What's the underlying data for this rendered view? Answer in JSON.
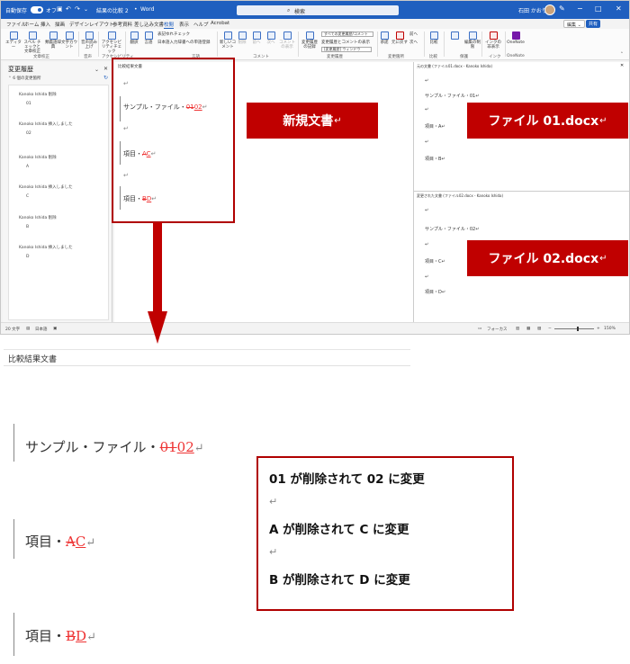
{
  "titlebar": {
    "autosave_label": "自動保存",
    "autosave_state": "オフ",
    "doc_name": "結果の比較 2",
    "app_name": "Word",
    "search_placeholder": "検索",
    "user_name": "石田 かおり"
  },
  "menu": {
    "items": [
      "ファイル",
      "ホーム",
      "挿入",
      "描画",
      "デザイン",
      "レイアウト",
      "参考資料",
      "差し込み文書",
      "校閲",
      "表示",
      "ヘルプ",
      "Acrobat"
    ],
    "active": "校閲",
    "edit_mode": "編集",
    "share": "共有"
  },
  "ribbon": {
    "buttons": [
      {
        "label": "エディター",
        "icon": "editor-icon"
      },
      {
        "label": "スペル チェックと文章校正",
        "icon": "spellcheck-icon"
      },
      {
        "label": "類義語辞典",
        "icon": "thesaurus-icon"
      },
      {
        "label": "文字カウント",
        "icon": "word-count-icon"
      },
      {
        "label": "音声読み上げ",
        "icon": "read-aloud-icon"
      },
      {
        "label": "アクセシビリティチェック",
        "icon": "accessibility-icon"
      },
      {
        "label": "翻訳",
        "icon": "translate-icon"
      },
      {
        "label": "言語",
        "icon": "language-icon"
      },
      {
        "label": "新しいコメント",
        "icon": "new-comment-icon"
      },
      {
        "label": "削除",
        "icon": "delete-comment-icon"
      },
      {
        "label": "前へ",
        "icon": "prev-comment-icon"
      },
      {
        "label": "次へ",
        "icon": "next-comment-icon"
      },
      {
        "label": "コメントの表示",
        "icon": "show-comments-icon"
      },
      {
        "label": "変更履歴の記録",
        "icon": "track-changes-icon"
      },
      {
        "label": "承諾",
        "icon": "accept-icon"
      },
      {
        "label": "元に戻す",
        "icon": "reject-icon"
      },
      {
        "label": "比較",
        "icon": "compare-icon"
      },
      {
        "label": "編集の制限",
        "icon": "restrict-icon"
      },
      {
        "label": "インクの非表示",
        "icon": "ink-icon"
      },
      {
        "label": "OneNote",
        "icon": "onenote-icon"
      }
    ],
    "small_items": [
      "表記ゆれチェック",
      "日本語入力辞書への単語登録",
      "すべての変更履歴/コメント",
      "変更履歴とコメントの表示",
      "[変更履歴] ウィンドウ",
      "前へ",
      "次へ"
    ],
    "groups": [
      "文章校正",
      "音声",
      "アクセシビリティ",
      "言語",
      "コメント",
      "変更履歴",
      "変更箇所",
      "比較",
      "保護",
      "インク",
      "OneNote"
    ]
  },
  "revisions": {
    "title": "変更履歴",
    "count": "6 個の変更箇所",
    "items": [
      {
        "author": "Kanoko Ishida 削除",
        "value": "01"
      },
      {
        "author": "Kanoko Ishida 挿入しました",
        "value": "02"
      },
      {
        "author": "Kanoko Ishida 削除",
        "value": "A"
      },
      {
        "author": "Kanoko Ishida 挿入しました",
        "value": "C"
      },
      {
        "author": "Kanoko Ishida 削除",
        "value": "B"
      },
      {
        "author": "Kanoko Ishida 挿入しました",
        "value": "D"
      }
    ]
  },
  "compared": {
    "label": "比較結果文書",
    "lines": {
      "l1_prefix": "サンプル・ファイル・",
      "l1_del": "01",
      "l1_ins": "02",
      "l2_prefix": "項目・",
      "l2_del": "A",
      "l2_ins": "C",
      "l3_prefix": "項目・",
      "l3_del": "B",
      "l3_ins": "D"
    },
    "return_mark": "↵"
  },
  "original": {
    "label": "元の文書 (ファイル01.docx - Kanoko Ishida)",
    "lines": [
      "サンプル・ファイル・01↵",
      "項目・A↵",
      "項目・B↵"
    ]
  },
  "revised": {
    "label": "変更された文書 (ファイル02.docx - Kanoko Ishida)",
    "lines": [
      "サンプル・ファイル・02↵",
      "項目・C↵",
      "項目・D↵"
    ]
  },
  "status": {
    "word_count": "20 文字",
    "language": "日本語",
    "focus": "フォーカス",
    "zoom": "150%"
  },
  "callouts": {
    "new_doc": "新規文書",
    "file1": "ファイル 01.docx",
    "file2": "ファイル 02.docx"
  },
  "zoomed": {
    "label": "比較結果文書"
  },
  "explanation": {
    "line1": "01 が削除されて 02 に変更",
    "line2": "A が削除されて C に変更",
    "line3": "B が削除されて D に変更"
  }
}
